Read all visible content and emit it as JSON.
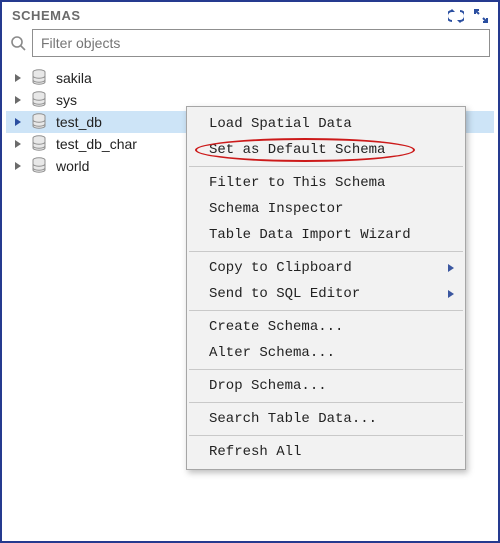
{
  "header": {
    "title": "SCHEMAS"
  },
  "search": {
    "placeholder": "Filter objects"
  },
  "tree": {
    "items": [
      {
        "label": "sakila"
      },
      {
        "label": "sys"
      },
      {
        "label": "test_db"
      },
      {
        "label": "test_db_char"
      },
      {
        "label": "world"
      }
    ],
    "selected_index": 2
  },
  "context_menu": {
    "items": [
      {
        "label": "Load Spatial Data"
      },
      {
        "label": "Set as Default Schema",
        "highlighted": true
      },
      {
        "sep": true
      },
      {
        "label": "Filter to This Schema"
      },
      {
        "label": "Schema Inspector"
      },
      {
        "label": "Table Data Import Wizard"
      },
      {
        "sep": true
      },
      {
        "label": "Copy to Clipboard",
        "submenu": true
      },
      {
        "label": "Send to SQL Editor",
        "submenu": true
      },
      {
        "sep": true
      },
      {
        "label": "Create Schema..."
      },
      {
        "label": "Alter Schema..."
      },
      {
        "sep": true
      },
      {
        "label": "Drop Schema..."
      },
      {
        "sep": true
      },
      {
        "label": "Search Table Data..."
      },
      {
        "sep": true
      },
      {
        "label": "Refresh All"
      }
    ]
  }
}
